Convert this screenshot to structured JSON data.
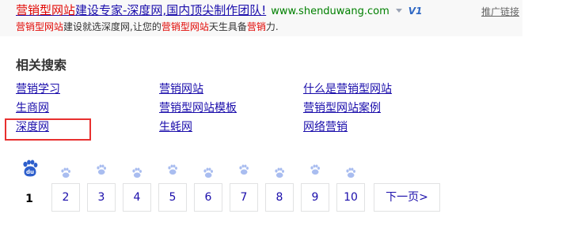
{
  "ad": {
    "title_parts": [
      {
        "text": "营销型网站",
        "hl": true
      },
      {
        "text": "建设专家-深度网,国内顶尖制作团队!",
        "hl": false
      }
    ],
    "url": "www.shenduwang.com",
    "badge": "V1",
    "sponsored_label": "推广链接",
    "desc_parts": [
      {
        "text": "营销型网站",
        "hl": true
      },
      {
        "text": "建设就选深度网,让您的",
        "hl": false
      },
      {
        "text": "营销型网站",
        "hl": true
      },
      {
        "text": "天生具备",
        "hl": false
      },
      {
        "text": "营销",
        "hl": true
      },
      {
        "text": "力.",
        "hl": false
      }
    ]
  },
  "related": {
    "title": "相关搜索",
    "items": [
      {
        "label": "营销学习"
      },
      {
        "label": "营销网站"
      },
      {
        "label": "什么是营销型网站"
      },
      {
        "label": "生商网"
      },
      {
        "label": "营销型网站模板"
      },
      {
        "label": "营销型网站案例"
      },
      {
        "label": "深度网"
      },
      {
        "label": "生蚝网"
      },
      {
        "label": "网络营销"
      }
    ]
  },
  "pagination": {
    "logo_text": "du",
    "current": "1",
    "pages": [
      "2",
      "3",
      "4",
      "5",
      "6",
      "7",
      "8",
      "9",
      "10"
    ],
    "next_label": "下一页>"
  },
  "colors": {
    "link": "#1a0dab",
    "highlight": "#e10602",
    "url_green": "#008000",
    "paw_big": "#2e5fcc",
    "paw_small": "#a9bdf0",
    "annotation_box": "#e8302f"
  }
}
